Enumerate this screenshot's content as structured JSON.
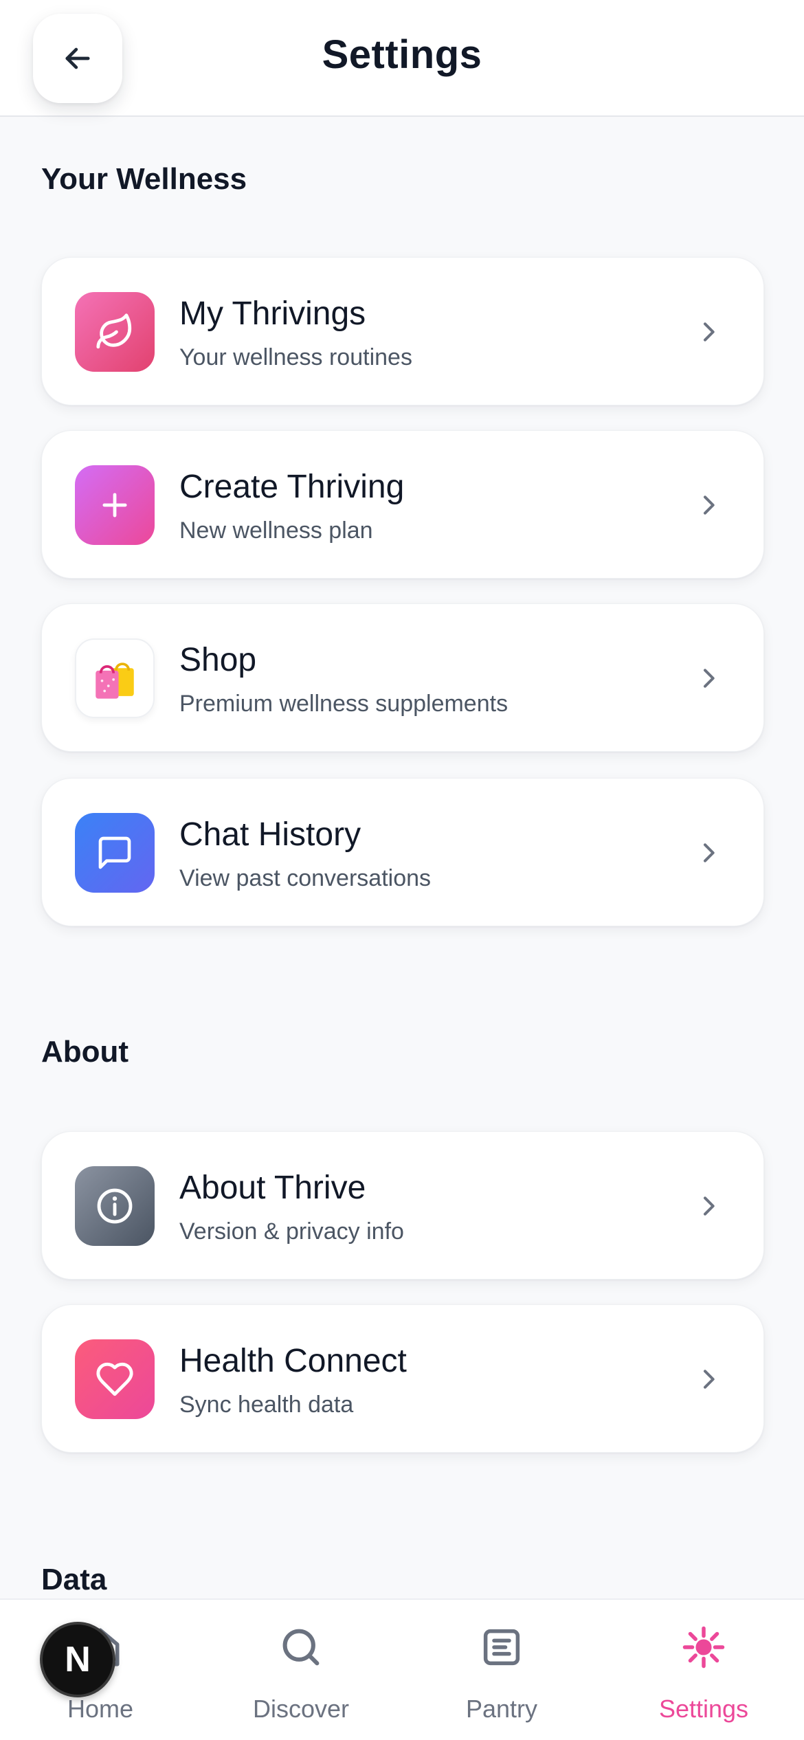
{
  "header": {
    "title": "Settings"
  },
  "sections": {
    "wellness": {
      "title": "Your Wellness",
      "items": [
        {
          "title": "My Thrivings",
          "subtitle": "Your wellness routines",
          "icon": "leaf-icon",
          "color": "#ec4899"
        },
        {
          "title": "Create Thriving",
          "subtitle": "New wellness plan",
          "icon": "plus-icon",
          "color": "#d946ef"
        },
        {
          "title": "Shop",
          "subtitle": "Premium wellness supplements",
          "icon": "shopping-bags-icon"
        },
        {
          "title": "Chat History",
          "subtitle": "View past conversations",
          "icon": "chat-bubble-icon",
          "color": "#3b82f6"
        }
      ]
    },
    "about": {
      "title": "About",
      "items": [
        {
          "title": "About Thrive",
          "subtitle": "Version & privacy info",
          "icon": "info-icon",
          "color": "#6b7280"
        },
        {
          "title": "Health Connect",
          "subtitle": "Sync health data",
          "icon": "heart-icon",
          "color": "#fb4f7c"
        }
      ]
    },
    "data": {
      "title": "Data"
    }
  },
  "bottom_nav": {
    "items": [
      {
        "label": "Home",
        "icon": "home-icon",
        "active": false
      },
      {
        "label": "Discover",
        "icon": "search-icon",
        "active": false
      },
      {
        "label": "Pantry",
        "icon": "pantry-icon",
        "active": false
      },
      {
        "label": "Settings",
        "icon": "settings-sparkle-icon",
        "active": true
      }
    ],
    "active_color": "#ec4899"
  },
  "dev_badge": {
    "letter": "N"
  }
}
